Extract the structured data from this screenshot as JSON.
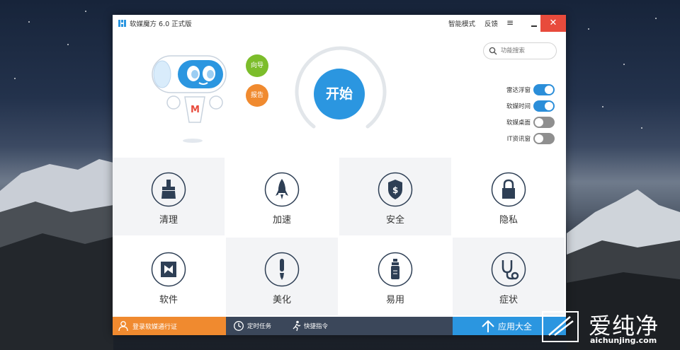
{
  "window": {
    "title": "软媒魔方 6.0 正式版",
    "smart_mode": "智能模式",
    "feedback": "反馈",
    "menu_glyph": "≡",
    "close_glyph": "✕"
  },
  "side_buttons": {
    "guide": "向导",
    "report": "报告"
  },
  "start": {
    "label": "开始"
  },
  "search": {
    "placeholder": "功能搜索"
  },
  "toggles": [
    {
      "label": "雷达浮窗",
      "on": true
    },
    {
      "label": "软媒时间",
      "on": true
    },
    {
      "label": "软媒桌面",
      "on": false
    },
    {
      "label": "IT资讯窗",
      "on": false
    }
  ],
  "tiles": [
    {
      "label": "清理",
      "icon": "broom-icon"
    },
    {
      "label": "加速",
      "icon": "rocket-icon"
    },
    {
      "label": "安全",
      "icon": "shield-icon"
    },
    {
      "label": "隐私",
      "icon": "lock-icon"
    },
    {
      "label": "软件",
      "icon": "aperture-icon"
    },
    {
      "label": "美化",
      "icon": "brush-icon"
    },
    {
      "label": "易用",
      "icon": "bottle-icon"
    },
    {
      "label": "症状",
      "icon": "stethoscope-icon"
    }
  ],
  "bottom": {
    "login": "登录软媒通行证",
    "scheduled": "定时任务",
    "shortcut": "快捷指令",
    "apps": "应用大全"
  },
  "watermark": {
    "cn": "爱纯净",
    "url": "aichunjing.com"
  },
  "colors": {
    "accent": "#2b96e0",
    "close": "#e84b3c",
    "guide": "#7cbd2b",
    "report": "#f08a2f",
    "bottom_bar": "#3b475a",
    "icon": "#2e3f55"
  }
}
